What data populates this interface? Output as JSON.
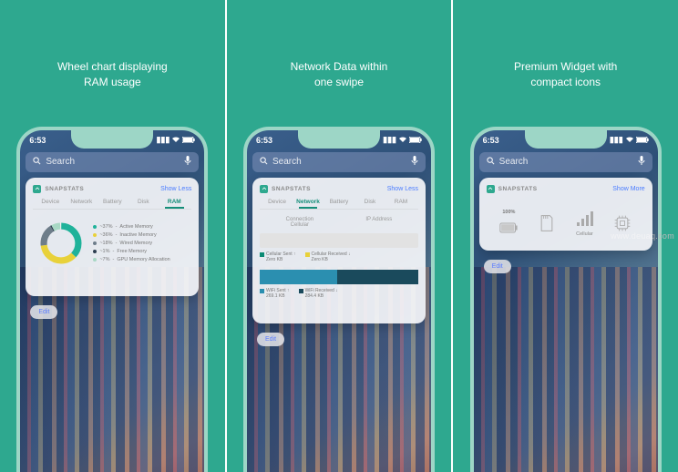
{
  "watermark": "www.deuaq.com",
  "panels": [
    {
      "caption": "Wheel chart displaying\nRAM usage",
      "time": "6:53",
      "search_placeholder": "Search",
      "widget_title": "SNAPSTATS",
      "show_link": "Show Less",
      "tabs": [
        "Device",
        "Network",
        "Battery",
        "Disk",
        "RAM"
      ],
      "active_tab": 4,
      "edit": "Edit",
      "ram_legend": [
        {
          "pct": "~37%",
          "label": "Active Memory",
          "color": "#1fb29a"
        },
        {
          "pct": "~36%",
          "label": "Inactive Memory",
          "color": "#e8d13a"
        },
        {
          "pct": "~18%",
          "label": "Wired Memory",
          "color": "#6d7d8a"
        },
        {
          "pct": "~1%",
          "label": "Free Memory",
          "color": "#2c3e50"
        },
        {
          "pct": "~7%",
          "label": "GPU Memory Allocation",
          "color": "#a8d8c4"
        }
      ]
    },
    {
      "caption": "Network Data within\none swipe",
      "time": "6:53",
      "search_placeholder": "Search",
      "widget_title": "SNAPSTATS",
      "show_link": "Show Less",
      "tabs": [
        "Device",
        "Network",
        "Battery",
        "Disk",
        "RAM"
      ],
      "active_tab": 1,
      "edit": "Edit",
      "net_subtabs": [
        "Connection\nCellular",
        "IP Address"
      ],
      "cellular": [
        {
          "label": "Cellular Sent ↑",
          "value": "Zero KB",
          "color": "#0b8a73"
        },
        {
          "label": "Cellular Received ↓",
          "value": "Zero KB",
          "color": "#e8d13a"
        }
      ],
      "wifi": [
        {
          "label": "WiFi Sent ↑",
          "value": "269.1 KB",
          "color": "#2b8fb0"
        },
        {
          "label": "WiFi Received ↓",
          "value": "284.4 KB",
          "color": "#1a4a5c"
        }
      ]
    },
    {
      "caption": "Premium Widget with\ncompact icons",
      "time": "6:53",
      "search_placeholder": "Search",
      "widget_title": "SNAPSTATS",
      "show_link": "Show More",
      "edit": "Edit",
      "icons": [
        {
          "name": "battery",
          "label": "",
          "pct": "100%"
        },
        {
          "name": "memory",
          "label": ""
        },
        {
          "name": "cellular",
          "label": "Cellular"
        },
        {
          "name": "cpu",
          "label": ""
        }
      ]
    }
  ],
  "colors": {
    "brand": "#2EA88F",
    "link": "#4a7cff"
  }
}
